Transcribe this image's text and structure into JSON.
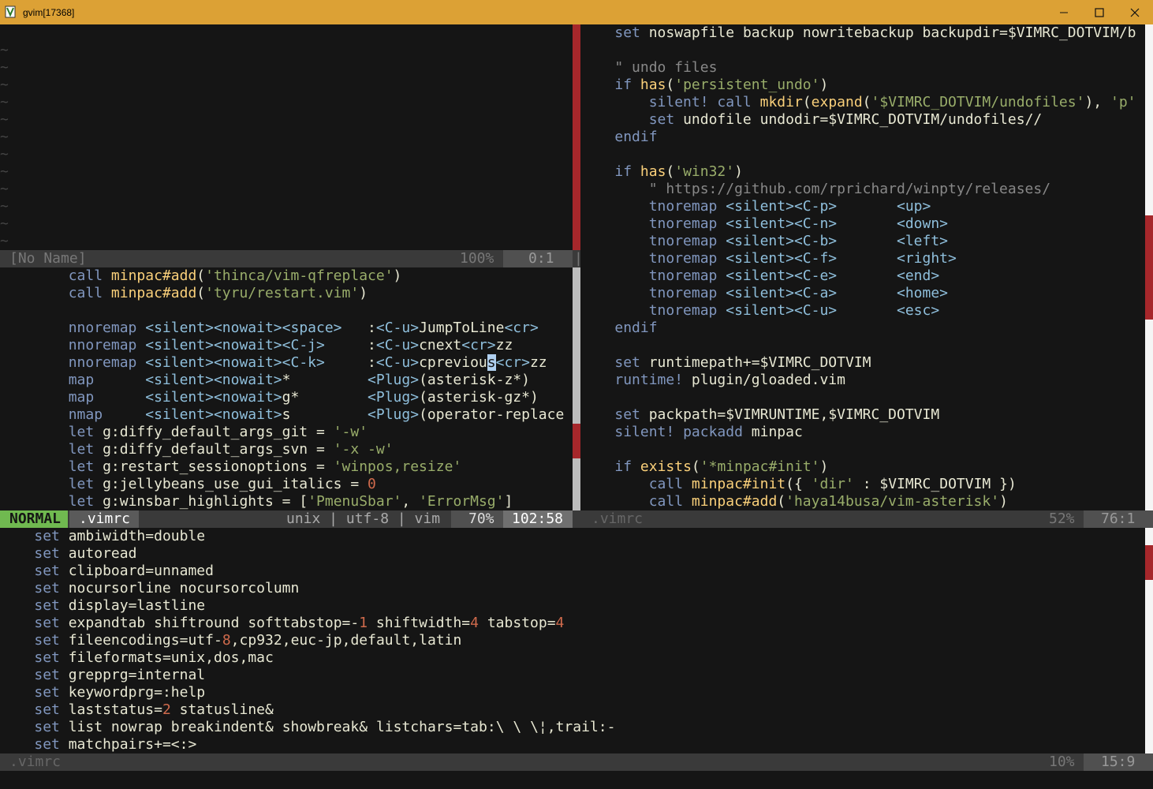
{
  "window": {
    "title": "gvim[17368]",
    "minimize_label": "—",
    "maximize_label": "☐",
    "close_label": "✕"
  },
  "top_left": {
    "tilde": "~",
    "status": {
      "name": "[No Name]",
      "percent": "100%",
      "position": "0:1",
      "end_mark": "|"
    }
  },
  "middle_left": {
    "lines": [
      "        call minpac#add('thinca/vim-qfreplace')",
      "        call minpac#add('tyru/restart.vim')",
      "",
      "        nnoremap <silent><nowait><space>   :<C-u>JumpToLine<cr>",
      "        nnoremap <silent><nowait><C-j>     :<C-u>cnext<cr>zz",
      "        nnoremap <silent><nowait><C-k>     :<C-u>cprevious<cr>zz",
      "        map      <silent><nowait>*         <Plug>(asterisk-z*)",
      "        map      <silent><nowait>g*        <Plug>(asterisk-gz*)",
      "        nmap     <silent><nowait>s         <Plug>(operator-replace",
      "        let g:diffy_default_args_git = '-w'",
      "        let g:diffy_default_args_svn = '-x -w'",
      "        let g:restart_sessionoptions = 'winpos,resize'",
      "        let g:jellybeans_use_gui_italics = 0",
      "        let g:winsbar_highlights = ['PmenuSbar', 'ErrorMsg']"
    ],
    "status": {
      "mode": "NORMAL",
      "name": ".vimrc",
      "fileinfo": "unix | utf-8 | vim",
      "percent": "70%",
      "position": "102:58"
    }
  },
  "right": {
    "lines": [
      "    set noswapfile backup nowritebackup backupdir=$VIMRC_DOTVIM/b",
      "",
      "    \" undo files",
      "    if has('persistent_undo')",
      "        silent! call mkdir(expand('$VIMRC_DOTVIM/undofiles'), 'p'",
      "        set undofile undodir=$VIMRC_DOTVIM/undofiles//",
      "    endif",
      "",
      "    if has('win32')",
      "        \" https://github.com/rprichard/winpty/releases/",
      "        tnoremap <silent><C-p>       <up>",
      "        tnoremap <silent><C-n>       <down>",
      "        tnoremap <silent><C-b>       <left>",
      "        tnoremap <silent><C-f>       <right>",
      "        tnoremap <silent><C-e>       <end>",
      "        tnoremap <silent><C-a>       <home>",
      "        tnoremap <silent><C-u>       <esc>",
      "    endif",
      "",
      "    set runtimepath+=$VIMRC_DOTVIM",
      "    runtime! plugin/gloaded.vim",
      "",
      "    set packpath=$VIMRUNTIME,$VIMRC_DOTVIM",
      "    silent! packadd minpac",
      "",
      "    if exists('*minpac#init')",
      "        call minpac#init({ 'dir' : $VIMRC_DOTVIM })",
      "        call minpac#add('haya14busa/vim-asterisk')"
    ],
    "status": {
      "name": ".vimrc",
      "percent": "52%",
      "position": "76:1"
    }
  },
  "bottom": {
    "lines": [
      "    set ambiwidth=double",
      "    set autoread",
      "    set clipboard=unnamed",
      "    set nocursorline nocursorcolumn",
      "    set display=lastline",
      "    set expandtab shiftround softtabstop=-1 shiftwidth=4 tabstop=4",
      "    set fileencodings=utf-8,cp932,euc-jp,default,latin",
      "    set fileformats=unix,dos,mac",
      "    set grepprg=internal",
      "    set keywordprg=:help",
      "    set laststatus=2 statusline&",
      "    set list nowrap breakindent& showbreak& listchars=tab:\\ \\ \\¦,trail:-",
      "    set matchpairs+=<:>"
    ],
    "status": {
      "name": ".vimrc",
      "percent": "10%",
      "position": "15:9"
    }
  },
  "colors": {
    "titlebar": "#dca135",
    "background": "#151515",
    "mode_normal_bg": "#70b950",
    "scroll_thumb": "#a6272b",
    "keyword": "#8197bf",
    "function": "#fad07a",
    "string": "#99ad6a",
    "comment": "#888888",
    "special": "#8fbfdc",
    "number": "#cf6a4c"
  }
}
